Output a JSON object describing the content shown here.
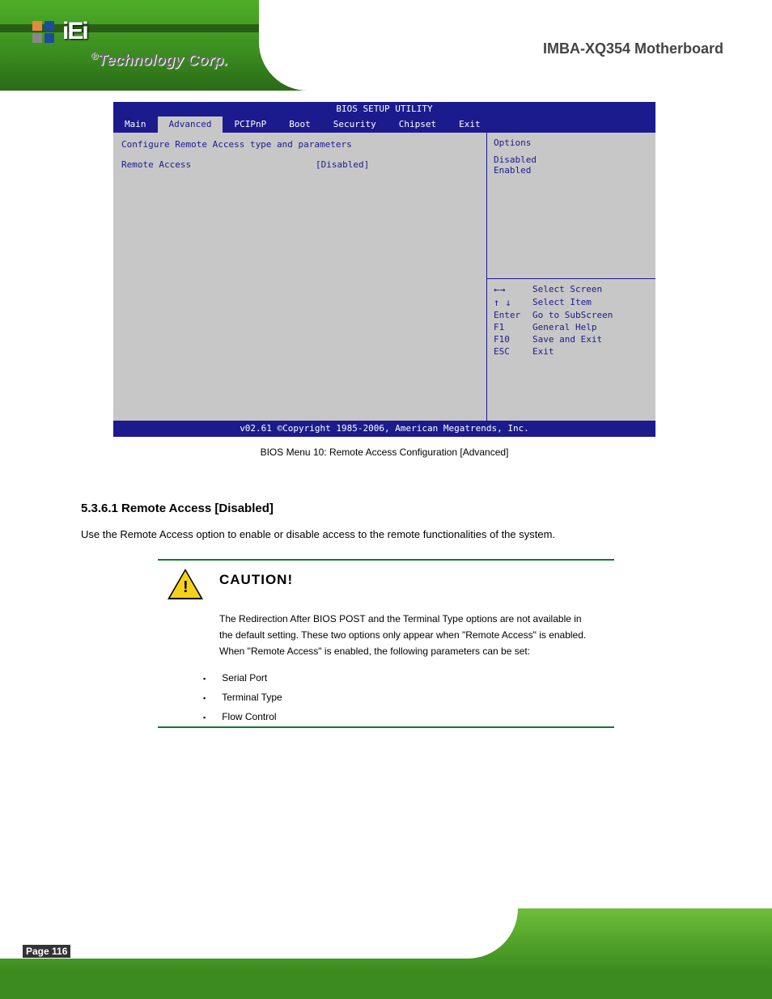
{
  "header": {
    "brand_text": "Technology Corp.",
    "logo_text": "iEi",
    "page_title": "IMBA-XQ354 Motherboard"
  },
  "bios": {
    "title": "BIOS SETUP UTILITY",
    "tabs": [
      "Main",
      "Advanced",
      "PCIPnP",
      "Boot",
      "Security",
      "Chipset",
      "Exit"
    ],
    "active_tab": 1,
    "hint_top": "Options",
    "options": [
      "Disabled",
      "Enabled"
    ],
    "keys": [
      {
        "k": "←→",
        "v": "Select Screen"
      },
      {
        "k": "↑ ↓",
        "v": "Select Item"
      },
      {
        "k": "Enter",
        "v": "Go to SubScreen"
      },
      {
        "k": "F1",
        "v": "General Help"
      },
      {
        "k": "F10",
        "v": "Save and Exit"
      },
      {
        "k": "ESC",
        "v": "Exit"
      }
    ],
    "footer": "v02.61 ©Copyright 1985-2006, American Megatrends, Inc.",
    "menu_heading": "Configure Remote Access type and parameters",
    "menu": [
      {
        "label": "Remote Access",
        "value": "[Disabled]"
      }
    ]
  },
  "caption": "BIOS Menu 10: Remote Access Configuration [Advanced]",
  "section_heading": "5.3.6.1 Remote Access [Disabled]",
  "body_para": "Use the Remote Access option to enable or disable access to the remote functionalities of the system.",
  "caution": {
    "title": "CAUTION!",
    "text": "The Redirection After BIOS POST and the Terminal Type options are not available in the default setting. These two options only appear when \"Remote Access\" is enabled. When \"Remote Access\" is enabled, the following parameters can be set:",
    "bullets": [
      "Serial Port",
      "Terminal Type",
      "Flow Control"
    ]
  },
  "footer": {
    "page_no": "Page 116"
  }
}
